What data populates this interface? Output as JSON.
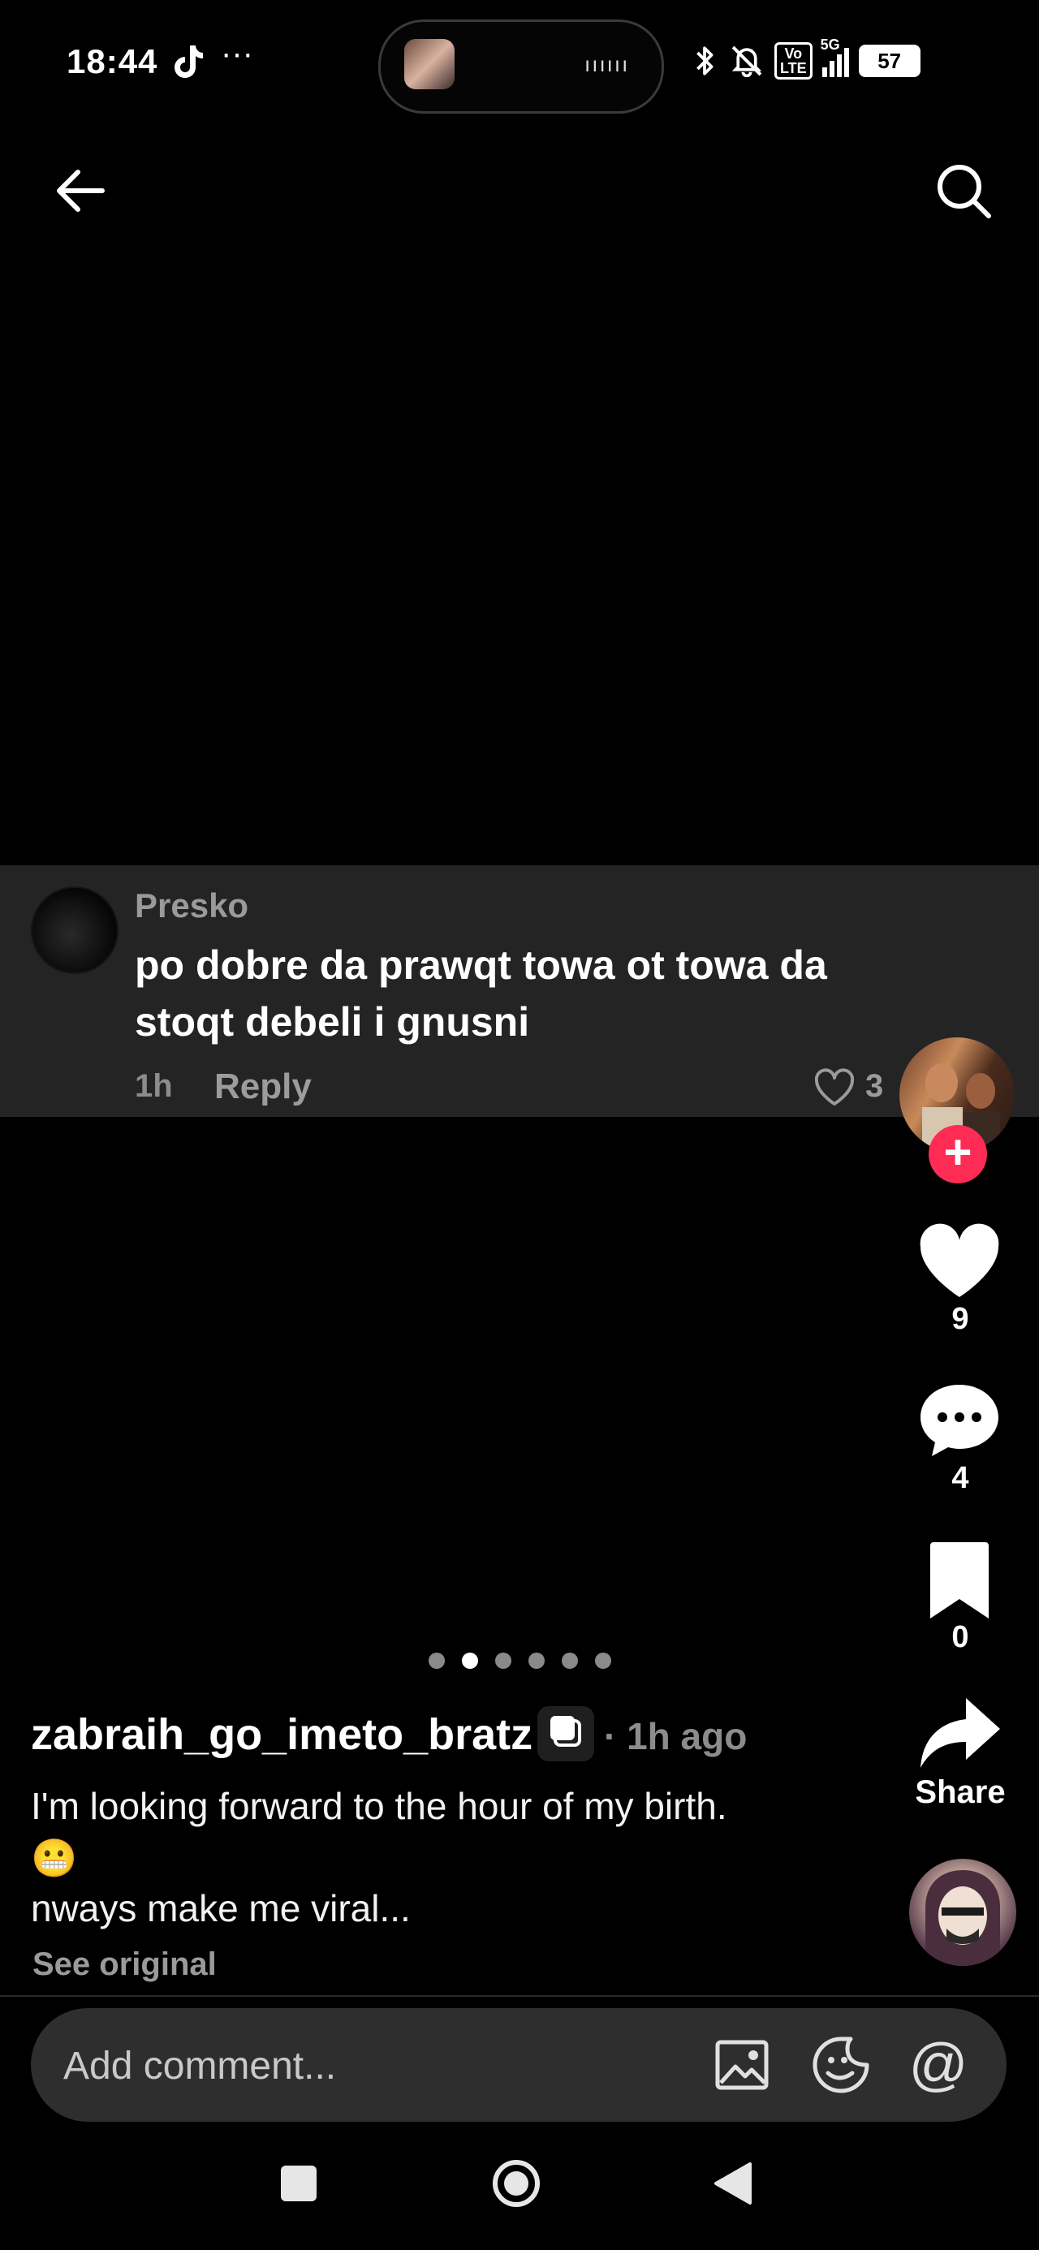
{
  "status_bar": {
    "time": "18:44",
    "more": "···",
    "battery": "57",
    "network": "5G",
    "volte": "Vo\nLTE",
    "island_wave": "ıııııı"
  },
  "nav": {
    "back_icon": "arrow-left-icon",
    "search_icon": "search-icon"
  },
  "comment": {
    "username": "Presko",
    "text": "po dobre da prawqt towa ot towa da stoqt debeli i gnusni",
    "time": "1h",
    "reply_label": "Reply",
    "likes": "3"
  },
  "actions": {
    "follow_symbol": "+",
    "likes": "9",
    "comments": "4",
    "bookmarks": "0",
    "share_label": "Share"
  },
  "carousel": {
    "total": 6,
    "active_index": 1
  },
  "post": {
    "author": "zabraih_go_imeto_bratz",
    "time": "· 1h ago",
    "caption_line1": "I'm looking forward to the hour of my birth.",
    "caption_emoji": "😬",
    "caption_line2": "nways make me viral...",
    "see_original": "See original"
  },
  "comment_bar": {
    "placeholder": "Add comment...",
    "mention": "@"
  },
  "colors": {
    "follow": "#fe2c55",
    "card": "#242424",
    "bar": "#2e2e2e"
  }
}
